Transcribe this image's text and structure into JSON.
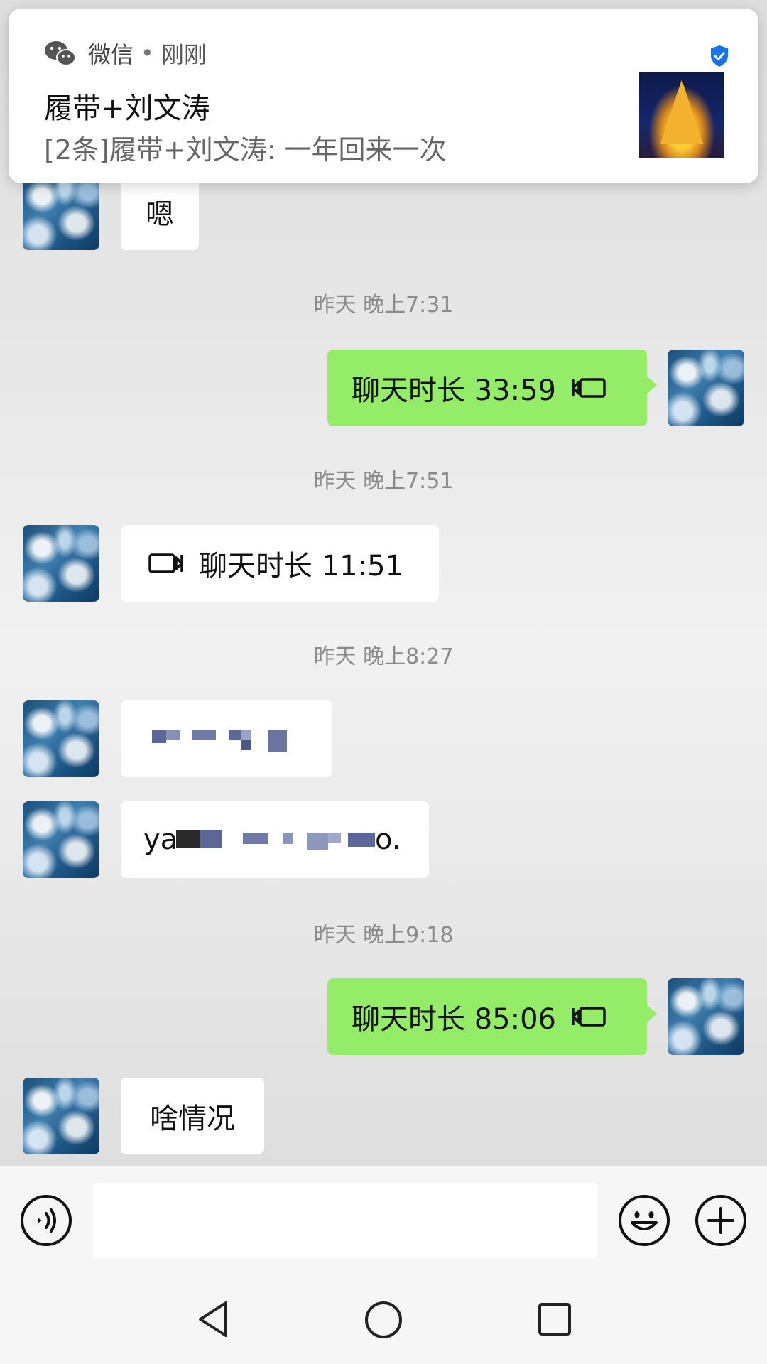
{
  "notification": {
    "app_name": "微信",
    "separator": "•",
    "time": "刚刚",
    "title": "履带+刘文涛",
    "body": "[2条]履带+刘文涛: 一年回来一次"
  },
  "messages": {
    "m1_text": "嗯",
    "ts1": "昨天 晚上7:31",
    "m2_text": "聊天时长 33:59",
    "ts2": "昨天 晚上7:51",
    "m3_text": "聊天时长 11:51",
    "ts3": "昨天 晚上8:27",
    "m5_prefix": "ya",
    "m5_suffix": "o.",
    "ts4": "昨天 晚上9:18",
    "m6_text": "聊天时长 85:06",
    "m7_text": "啥情况"
  },
  "input": {
    "placeholder": ""
  },
  "colors": {
    "sent_bubble": "#95ec69",
    "received_bubble": "#ffffff",
    "timestamp": "#8a8a8a",
    "verified_shield": "#1a73e8"
  },
  "icons": {
    "voice": "voice-icon",
    "emoji": "emoji-icon",
    "plus": "plus-icon",
    "video_call": "video-call-icon",
    "back": "nav-back-icon",
    "home": "nav-home-icon",
    "recents": "nav-recents-icon"
  }
}
